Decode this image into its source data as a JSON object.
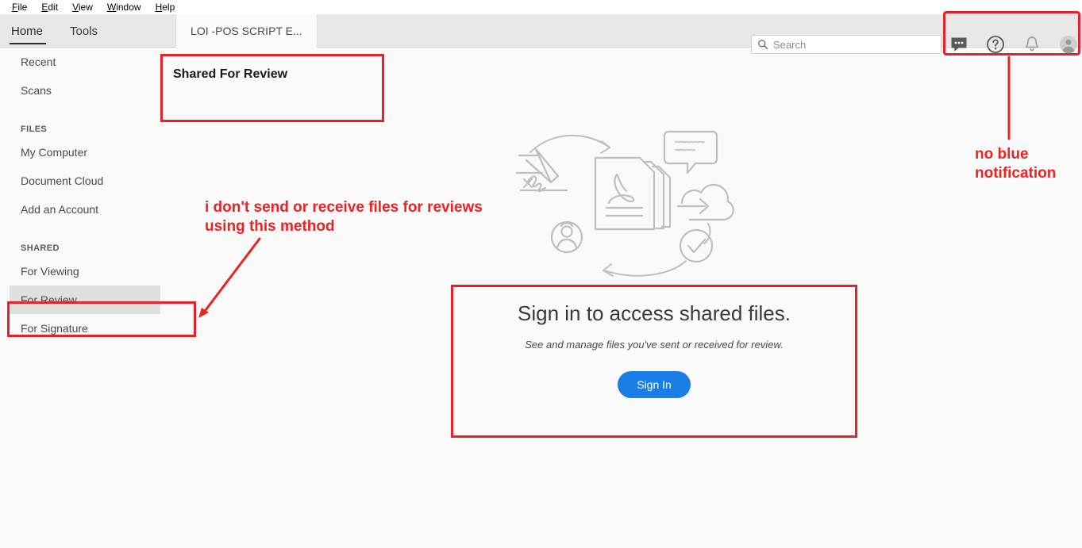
{
  "menubar": {
    "items": [
      {
        "mnemonic": "F",
        "rest": "ile"
      },
      {
        "mnemonic": "E",
        "rest": "dit"
      },
      {
        "mnemonic": "V",
        "rest": "iew"
      },
      {
        "mnemonic": "W",
        "rest": "indow"
      },
      {
        "mnemonic": "H",
        "rest": "elp"
      }
    ]
  },
  "tabs": {
    "home_label": "Home",
    "tools_label": "Tools",
    "document_label": "LOI -POS SCRIPT E..."
  },
  "search": {
    "placeholder": "Search",
    "value": "",
    "icon": "search-icon"
  },
  "topicons": [
    {
      "name": "chat-bubble-icon",
      "label": "Chat"
    },
    {
      "name": "help-circle-icon",
      "label": "Help"
    },
    {
      "name": "bell-icon",
      "label": "Notifications"
    },
    {
      "name": "user-avatar-icon",
      "label": "Account"
    }
  ],
  "sidebar": {
    "items": [
      {
        "label": "Recent",
        "type": "item",
        "selected": false
      },
      {
        "label": "Scans",
        "type": "item",
        "selected": false
      },
      {
        "label": "FILES",
        "type": "header"
      },
      {
        "label": "My Computer",
        "type": "item",
        "selected": false
      },
      {
        "label": "Document Cloud",
        "type": "item",
        "selected": false
      },
      {
        "label": "Add an Account",
        "type": "item",
        "selected": false
      },
      {
        "label": "SHARED",
        "type": "header"
      },
      {
        "label": "For Viewing",
        "type": "item",
        "selected": false
      },
      {
        "label": "For Review",
        "type": "item",
        "selected": true
      },
      {
        "label": "For Signature",
        "type": "item",
        "selected": false
      }
    ]
  },
  "main": {
    "page_title": "Shared For Review",
    "signin": {
      "title": "Sign in to access shared files.",
      "subtitle": "See and manage files you've sent or received for review.",
      "button_label": "Sign In"
    },
    "illustration_name": "shared-review-illustration"
  },
  "annotations": {
    "left_note": "i don't send or receive files for reviews using this method",
    "right_note_line1": "no blue",
    "right_note_line2": "notification",
    "color": "#ee2222"
  },
  "colors": {
    "accent_blue": "#1a7ee6",
    "annotation_red": "#ee2222",
    "toolbar_gray": "#e8e8e8",
    "selected_gray": "#e0e0e0",
    "page_background": "#fafafa"
  }
}
